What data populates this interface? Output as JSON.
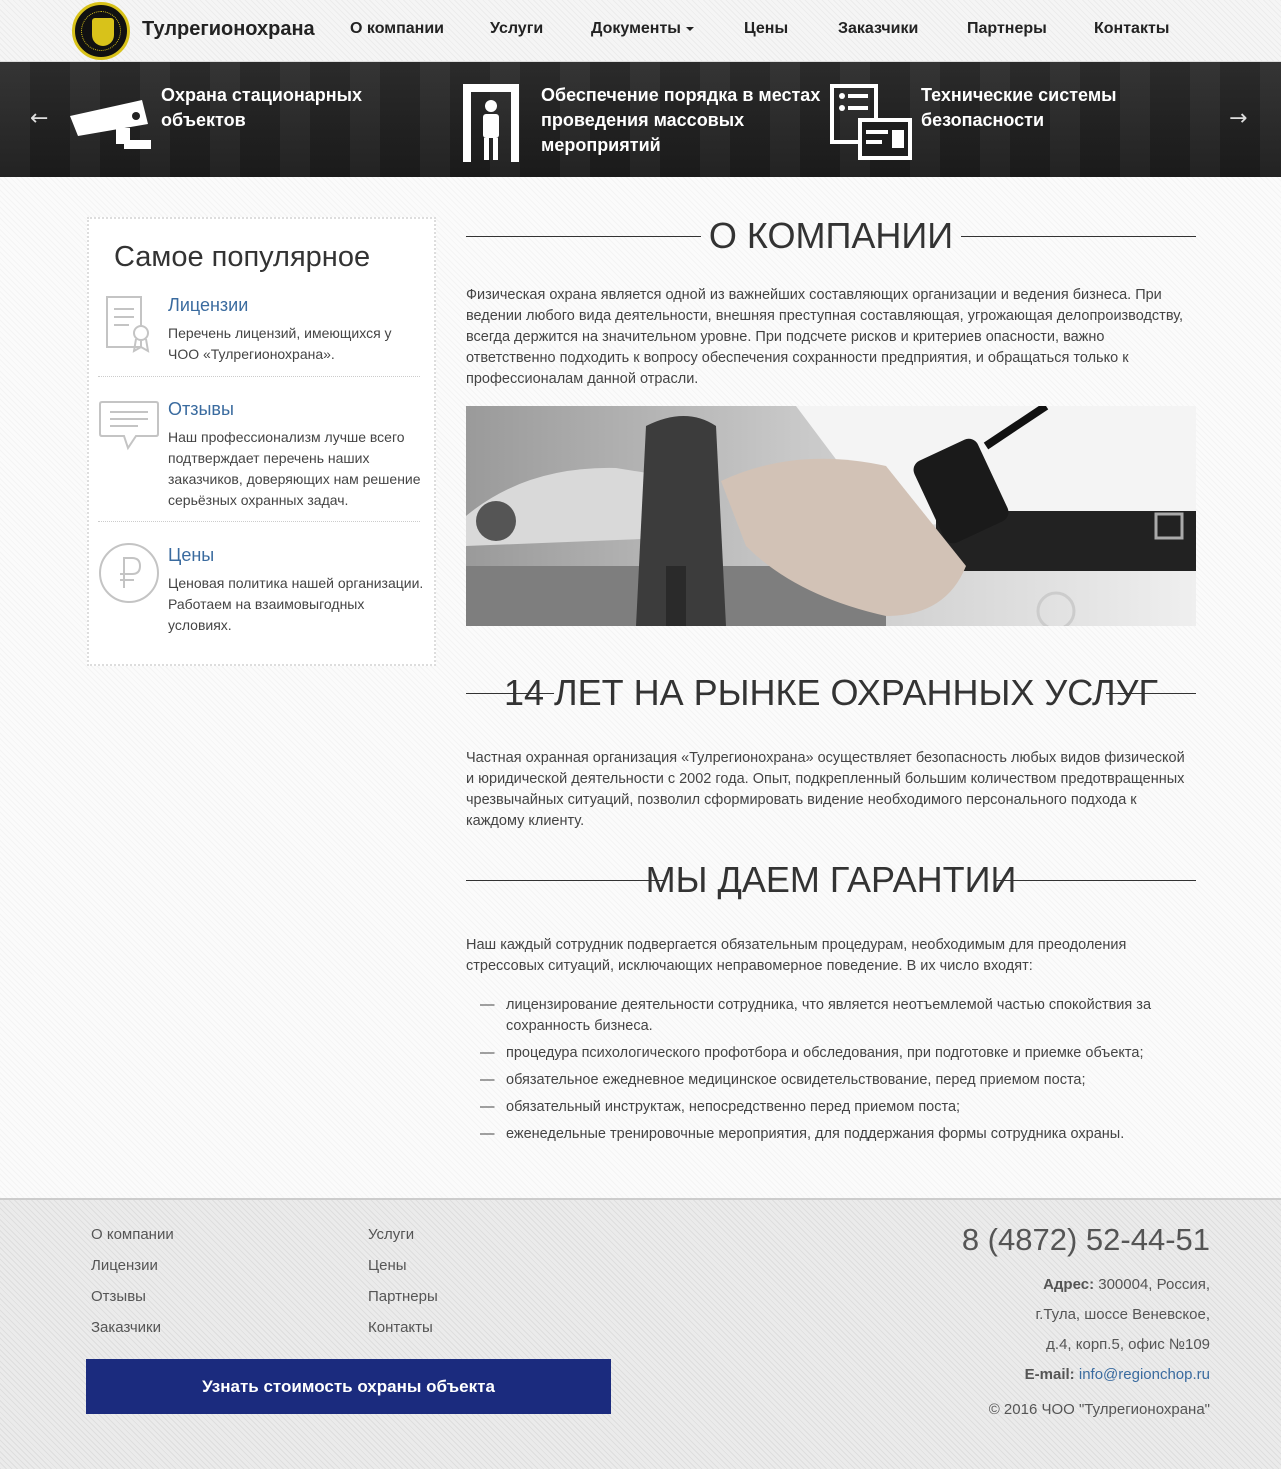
{
  "header": {
    "brand": "Тулрегионохрана",
    "nav": [
      {
        "label": "О компании"
      },
      {
        "label": "Услуги"
      },
      {
        "label": "Документы"
      },
      {
        "label": "Цены"
      },
      {
        "label": "Заказчики"
      },
      {
        "label": "Партнеры"
      },
      {
        "label": "Контакты"
      }
    ]
  },
  "slider": {
    "prev": "←",
    "next": "→",
    "slides": [
      {
        "title": "Охрана стационарных объектов",
        "icon": "cctv-camera-icon"
      },
      {
        "title": "Обеспечение порядка в местах проведения массовых мероприятий",
        "icon": "metal-detector-gate-icon"
      },
      {
        "title": "Технические системы безопасности",
        "icon": "access-control-card-icon"
      }
    ]
  },
  "sidebar": {
    "title": "Самое популярное",
    "items": [
      {
        "title": "Лицензии",
        "text": "Перечень лицензий, имеющихся у ЧОО «Тулрегионохрана».",
        "icon": "certificate-icon"
      },
      {
        "title": "Отзывы",
        "text": "Наш профессионализм лучше всего подтверждает перечень наших заказчиков, доверяющих нам решение серьёзных охранных задач.",
        "icon": "speech-bubble-icon"
      },
      {
        "title": "Цены",
        "text": "Ценовая политика нашей организации. Работаем на взаимовыгодных условиях.",
        "icon": "ruble-icon"
      }
    ]
  },
  "main": {
    "section1": {
      "title": "О КОМПАНИИ",
      "text": "Физическая охрана является одной из важнейших составляющих организации и ведения бизнеса. При ведении любого вида деятельности, внешняя преступная составляющая, угрожающая делопроизводству, всегда держится на значительном уровне. При подсчете рисков и критериев опасности, важно ответственно подходить к вопросу обеспечения сохранности предприятия, и обращаться только к профессионалам данной отрасли."
    },
    "section2": {
      "title": "14 ЛЕТ НА РЫНКЕ ОХРАННЫХ УСЛУГ",
      "text": "Частная охранная организация «Тулрегионохрана» осуществляет безопасность любых видов физической и юридической деятельности с 2002 года. Опыт, подкрепленный большим количеством предотвращенных чрезвычайных ситуаций, позволил сформировать видение необходимого персонального подхода к каждому клиенту."
    },
    "section3": {
      "title": "МЫ ДАЕМ ГАРАНТИИ",
      "text": "Наш каждый сотрудник подвергается обязательным процедурам, необходимым для преодоления стрессовых ситуаций, исключающих неправомерное поведение. В их число входят:",
      "bullet_mark": "—",
      "bullets": [
        "лицензирование деятельности сотрудника, что является неотъемлемой частью спокойствия за сохранность бизнеса.",
        "процедура психологического профотбора и обследования, при подготовке и приемке объекта;",
        "обязательное ежедневное медицинское освидетельствование, перед приемом поста;",
        "обязательный инструктаж, непосредственно перед приемом поста;",
        "еженедельные тренировочные мероприятия, для поддержания формы сотрудника охраны."
      ]
    }
  },
  "footer": {
    "col1": [
      "О компании",
      "Лицензии",
      "Отзывы",
      "Заказчики"
    ],
    "col2": [
      "Услуги",
      "Цены",
      "Партнеры",
      "Контакты"
    ],
    "cta": "Узнать стоимость охраны объекта",
    "phone": "8 (4872) 52-44-51",
    "address_label": "Адрес:",
    "address_line1": " 300004, Россия,",
    "address_line2": "г.Тула, шоссе Веневское,",
    "address_line3": "д.4, корп.5, офис №109",
    "email_label": "E-mail:",
    "email": "info@regionchop.ru",
    "copyright": "© 2016 ЧОО \"Тулрегионохрана\""
  },
  "colors": {
    "link": "#3a6b9f",
    "cta_bg": "#1b2b7e",
    "logo_gold": "#d8c21a"
  }
}
